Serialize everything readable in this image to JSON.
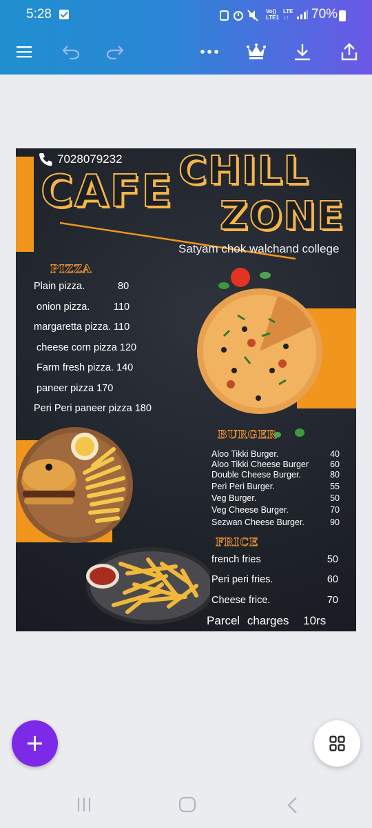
{
  "status": {
    "time": "5:28",
    "network_top": "Vo))",
    "network_bottom": "LTE1",
    "lte": "LTE",
    "battery": "70%"
  },
  "toolbar": {
    "menu_icon": "hamburger-icon",
    "undo_icon": "undo-icon",
    "redo_icon": "redo-icon",
    "more_icon": "more-icon",
    "premium_icon": "crown-icon",
    "download_icon": "download-icon",
    "share_icon": "share-icon"
  },
  "menu_card": {
    "phone": "7028079232",
    "title_cafe": "CAFE",
    "title_chill": "CHILL",
    "title_zone": "ZONE",
    "address": "Satyam chok walchand college",
    "pizza": {
      "heading": "PIZZA",
      "items": [
        {
          "name": "Plain pizza.",
          "price": "80"
        },
        {
          "name": "onion pizza.",
          "price": "110"
        },
        {
          "name": "margaretta pizza.",
          "price": "110"
        },
        {
          "name": "cheese corn pizza",
          "price": "120"
        },
        {
          "name": "Farm fresh pizza.",
          "price": "140"
        },
        {
          "name": "paneer pizza",
          "price": "170"
        },
        {
          "name": "Peri Peri paneer pizza",
          "price": "180"
        }
      ]
    },
    "burger": {
      "heading": "BURGER",
      "items": [
        {
          "name": "Aloo Tikki Burger.",
          "price": "40"
        },
        {
          "name": "Aloo Tikki Cheese Burger",
          "price": "60"
        },
        {
          "name": "Double Cheese Burger.",
          "price": "80"
        },
        {
          "name": "Peri Peri Burger.",
          "price": "55"
        },
        {
          "name": "Veg Burger.",
          "price": "50"
        },
        {
          "name": "Veg Cheese Burger.",
          "price": "70"
        },
        {
          "name": "Sezwan Cheese Burger.",
          "price": "90"
        }
      ]
    },
    "fries": {
      "heading": "FRICE",
      "items": [
        {
          "name": "french fries",
          "price": "50"
        },
        {
          "name": "Peri peri fries.",
          "price": "60"
        },
        {
          "name": "Cheese frice.",
          "price": "70"
        }
      ]
    },
    "parcel": {
      "label": "Parcel",
      "charges": "charges",
      "amount": "10rs"
    }
  },
  "colors": {
    "accent_orange": "#f2951d",
    "canva_purple": "#7d2ae8",
    "board": "#23272e"
  },
  "fabs": {
    "add_icon": "plus-icon",
    "pages_icon": "grid-icon"
  },
  "navbar": {
    "recent_icon": "recent-apps-icon",
    "home_icon": "home-icon",
    "back_icon": "back-icon"
  }
}
